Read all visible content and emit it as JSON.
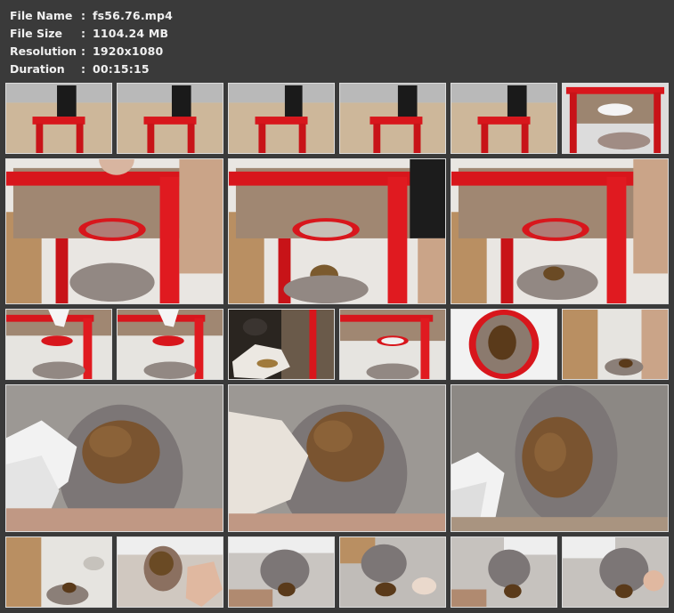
{
  "info": {
    "rows": [
      {
        "key": "File Name",
        "sep": ":",
        "value": "fs56.76.mp4"
      },
      {
        "key": "File Size",
        "sep": ":",
        "value": "1104.24 MB"
      },
      {
        "key": "Resolution",
        "sep": ":",
        "value": "1920x1080"
      },
      {
        "key": "Duration",
        "sep": ":",
        "value": "00:15:15"
      }
    ]
  },
  "colors": {
    "background": "#3a3a3a",
    "text": "#f0f0f0",
    "thumb_border": "#dcdcdc",
    "stool_red": "#d8161c"
  }
}
